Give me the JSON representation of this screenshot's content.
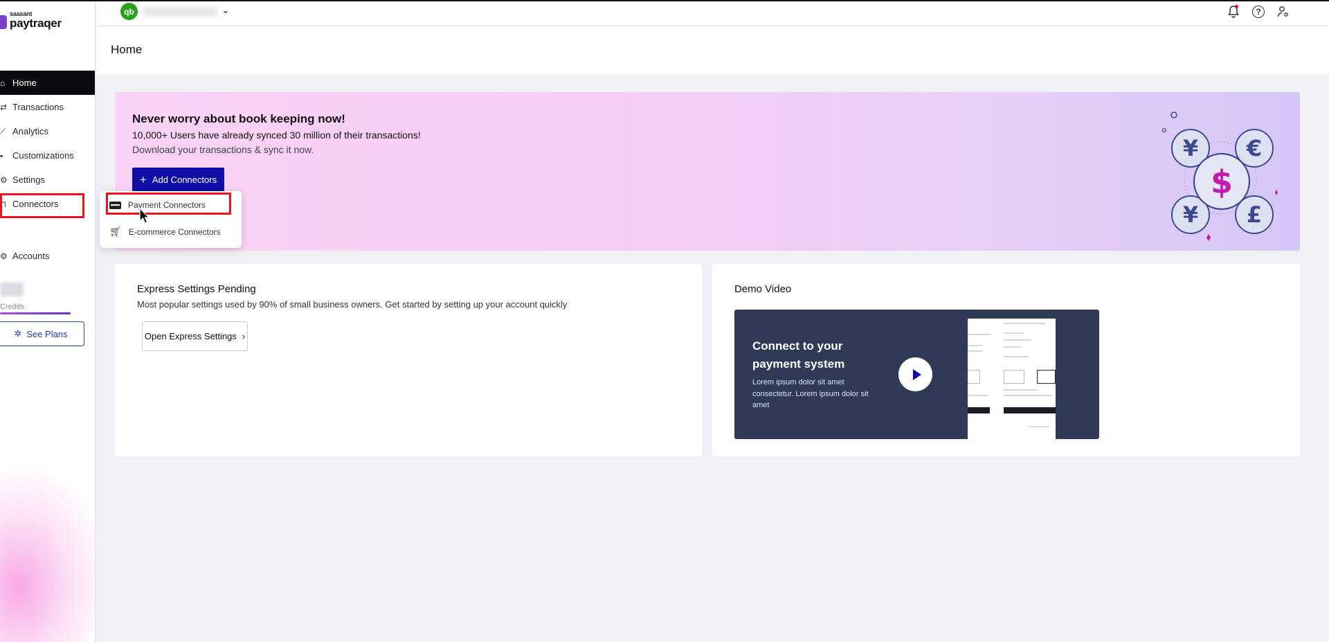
{
  "app": {
    "logo_small": "saasant",
    "logo_big": "paytraqer",
    "qb_logo_text": "qb"
  },
  "sidebar": {
    "items": [
      {
        "label": "Home",
        "icon": "home-icon"
      },
      {
        "label": "Transactions",
        "icon": "arrows-icon"
      },
      {
        "label": "Analytics",
        "icon": "chart-icon"
      },
      {
        "label": "Customizations",
        "icon": "grid-icon"
      },
      {
        "label": "Settings",
        "icon": "gear-icon"
      },
      {
        "label": "Connectors",
        "icon": "plug-icon"
      },
      {
        "label": "Accounts",
        "icon": "accounts-icon"
      }
    ],
    "credits_label": "Credits",
    "see_plans": "See Plans"
  },
  "header": {
    "page_title": "Home"
  },
  "banner": {
    "title": "Never worry about book keeping now!",
    "subtitle": "10,000+ Users have already synced 30 million of their transactions!",
    "subtitle2": "Download your transactions & sync it now.",
    "add_button": "Add Connectors",
    "accent_color": "#0f0fa8"
  },
  "dropdown": {
    "items": [
      {
        "label": "Payment Connectors",
        "icon": "credit-card-icon"
      },
      {
        "label": "E-commerce Connectors",
        "icon": "cart-icon"
      }
    ]
  },
  "express": {
    "title": "Express Settings Pending",
    "description": "Most popular settings used by 90% of small business owners. Get started by setting up your account quickly",
    "button": "Open Express Settings"
  },
  "demo": {
    "title": "Demo Video",
    "video_title": "Connect to your payment system",
    "video_text": "Lorem ipsum dolor sit amet consectetur. Lorem ipsum dolor sit amet"
  },
  "colors": {
    "highlight_red": "#e8131b",
    "video_bg": "#2f3a57"
  }
}
